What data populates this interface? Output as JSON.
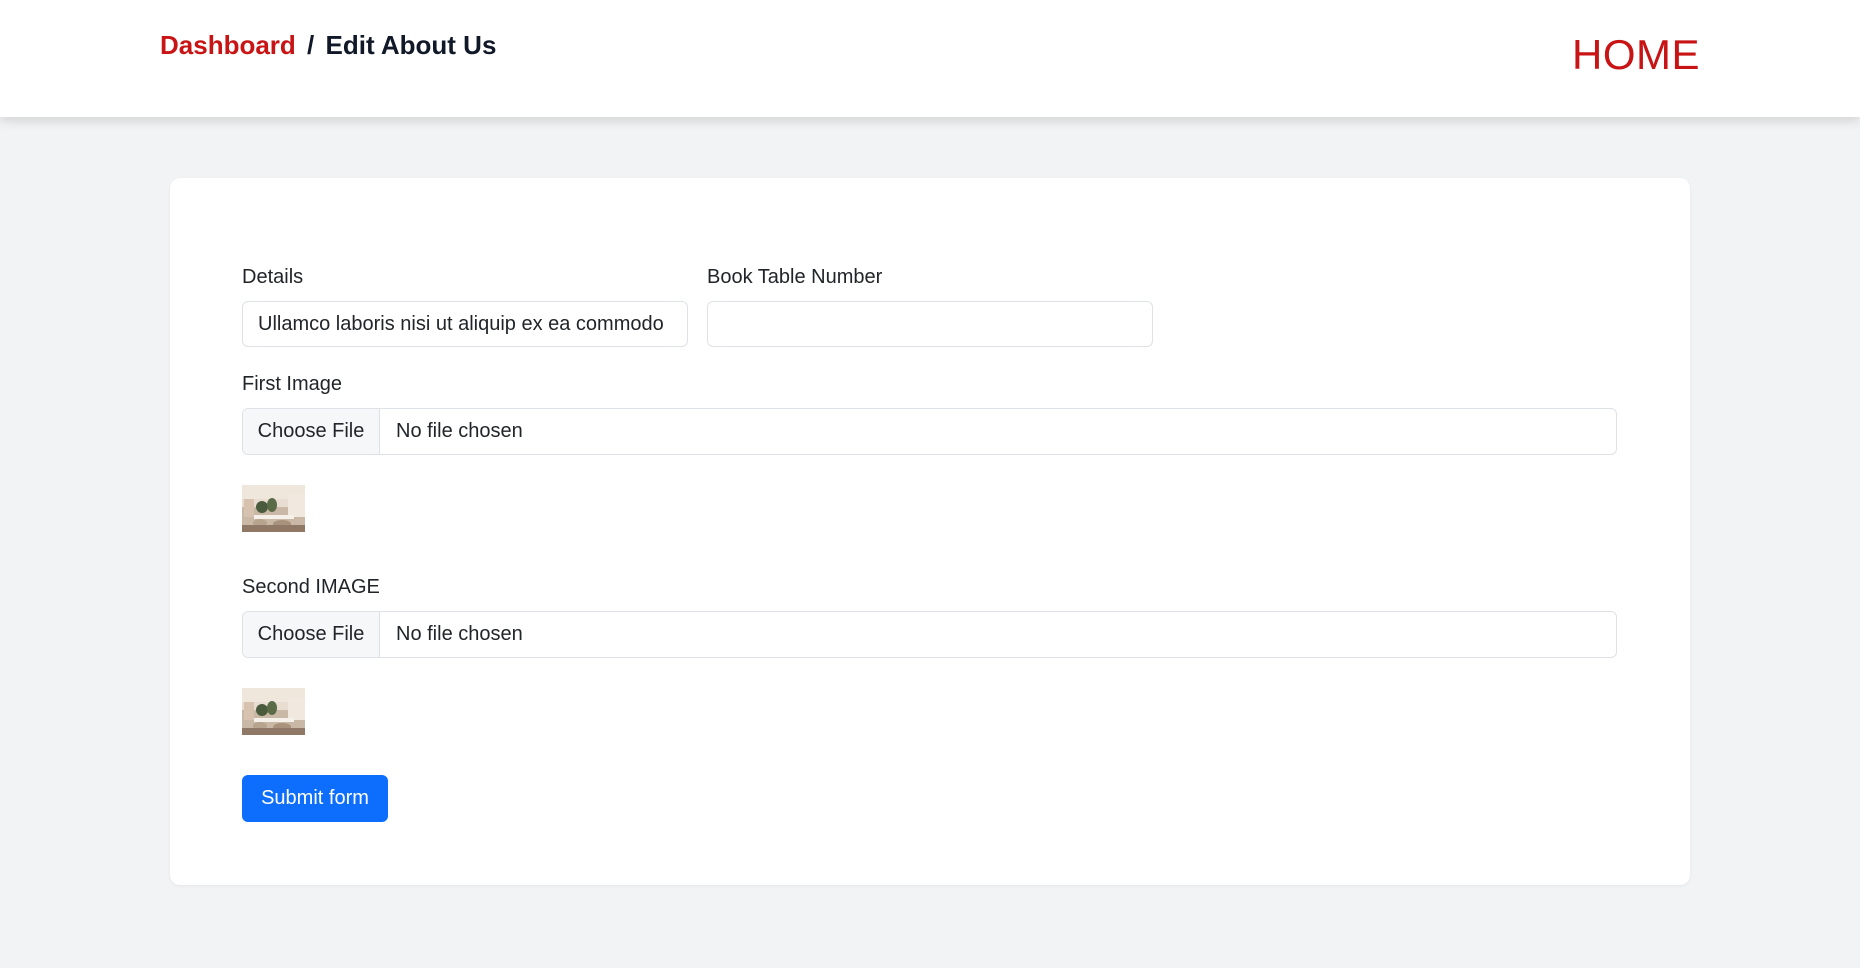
{
  "header": {
    "breadcrumb_link": "Dashboard",
    "breadcrumb_separator": "/",
    "breadcrumb_current": "Edit About Us",
    "home_link": "HOME",
    "accent_color": "#c81414"
  },
  "form": {
    "details": {
      "label": "Details",
      "value": "Ullamco laboris nisi ut aliquip ex ea commodo"
    },
    "book_table_number": {
      "label": "Book Table Number",
      "value": ""
    },
    "first_image": {
      "label": "First Image",
      "button_label": "Choose File",
      "status": "No file chosen",
      "preview_icon": "image-thumbnail-icon"
    },
    "second_image": {
      "label": "Second IMAGE",
      "button_label": "Choose File",
      "status": "No file chosen",
      "preview_icon": "image-thumbnail-icon"
    },
    "submit_label": "Submit form",
    "submit_color": "#0d6efd"
  }
}
